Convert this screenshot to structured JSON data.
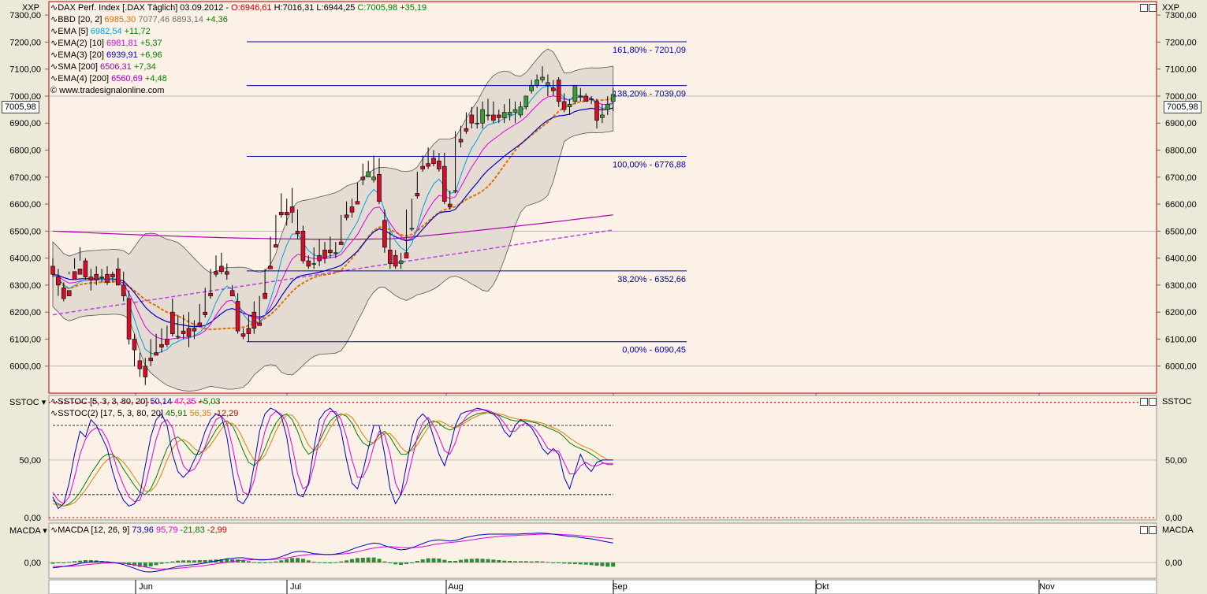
{
  "window": {
    "symbol_short": "XXP"
  },
  "legend_price": [
    {
      "parts": [
        {
          "t": "DAX Perf. Index [.DAX  Täglich] 03.09.2012 - ",
          "c": "#000"
        },
        {
          "t": "O:6946,61",
          "c": "#c00000"
        },
        {
          "t": " H:7016,31 L:6944,25 ",
          "c": "#000"
        },
        {
          "t": "C:7005,98 +35,19",
          "c": "#008000"
        }
      ]
    },
    {
      "parts": [
        {
          "t": "BBD [20, 2] ",
          "c": "#000"
        },
        {
          "t": "6985,30",
          "c": "#e07000"
        },
        {
          "t": " 7077,46 6893,14",
          "c": "#707070"
        },
        {
          "t": " +4,36",
          "c": "#008000"
        }
      ]
    },
    {
      "parts": [
        {
          "t": "EMA [5] ",
          "c": "#000"
        },
        {
          "t": "6982,54",
          "c": "#00a0e0"
        },
        {
          "t": " +11,72",
          "c": "#008000"
        }
      ]
    },
    {
      "parts": [
        {
          "t": "EMA(2) [10] ",
          "c": "#000"
        },
        {
          "t": "6981,81",
          "c": "#e000e0"
        },
        {
          "t": " +5,37",
          "c": "#008000"
        }
      ]
    },
    {
      "parts": [
        {
          "t": "EMA(3) [20] ",
          "c": "#000"
        },
        {
          "t": "6939,91",
          "c": "#0000c0"
        },
        {
          "t": " +6,96",
          "c": "#008000"
        }
      ]
    },
    {
      "parts": [
        {
          "t": "SMA [200] ",
          "c": "#000"
        },
        {
          "t": "6506,31",
          "c": "#b000b0"
        },
        {
          "t": " +7,34",
          "c": "#008000"
        }
      ]
    },
    {
      "parts": [
        {
          "t": "EMA(4) [200] ",
          "c": "#000"
        },
        {
          "t": "6560,69",
          "c": "#a000c0"
        },
        {
          "t": " +4,48",
          "c": "#008000"
        }
      ]
    },
    {
      "parts": [
        {
          "t": "© www.tradesignalonline.com",
          "c": "#000"
        }
      ]
    }
  ],
  "legend_sstoc": [
    {
      "parts": [
        {
          "t": "SSTOC [5, 3, 3, 80, 20] ",
          "c": "#000"
        },
        {
          "t": "50,14",
          "c": "#0000c0"
        },
        {
          "t": " 47,35",
          "c": "#e000e0"
        },
        {
          "t": " +5,03",
          "c": "#008000"
        }
      ]
    },
    {
      "parts": [
        {
          "t": "SSTOC(2) [17, 5, 3, 80, 20] ",
          "c": "#000"
        },
        {
          "t": "45,91",
          "c": "#008000"
        },
        {
          "t": " 56,35",
          "c": "#e08000"
        },
        {
          "t": " -12,29",
          "c": "#c00000"
        }
      ]
    }
  ],
  "legend_macd": [
    {
      "parts": [
        {
          "t": "MACDA [12, 26, 9] ",
          "c": "#000"
        },
        {
          "t": "73,96",
          "c": "#0000c0"
        },
        {
          "t": " 95,79",
          "c": "#e000e0"
        },
        {
          "t": " -21,83",
          "c": "#008000"
        },
        {
          "t": " -2,99",
          "c": "#c00000"
        }
      ]
    }
  ],
  "panes": {
    "price": "XXP",
    "sstoc": "SSTOC",
    "macd": "MACDA"
  },
  "last_price_tag": "7005,98",
  "chart_data": {
    "type": "candlestick",
    "x_labels": [
      "Jun",
      "Jul",
      "Aug",
      "Sep",
      "Okt",
      "Nov"
    ],
    "price_axis": {
      "ylim": [
        5900,
        7350
      ],
      "ticks": [
        "6000,00",
        "6100,00",
        "6200,00",
        "6300,00",
        "6400,00",
        "6500,00",
        "6600,00",
        "6700,00",
        "6800,00",
        "6900,00",
        "7000,00",
        "7100,00",
        "7200,00",
        "7300,00"
      ]
    },
    "sstoc_axis": {
      "ylim": [
        -2,
        106
      ],
      "ticks": [
        "0,00",
        "50,00"
      ]
    },
    "macd_axis": {
      "ylim": [
        -60,
        150
      ],
      "ticks": [
        "0,00"
      ]
    },
    "fib_levels": [
      {
        "label": "161,80% - 7201,09",
        "value": 7201.09
      },
      {
        "label": "138,20% - 7039,09",
        "value": 7039.09
      },
      {
        "label": "100,00% - 6776,88",
        "value": 6776.88
      },
      {
        "label": "38,20% - 6352,66",
        "value": 6352.66
      },
      {
        "label": "0,00% - 6090,45",
        "value": 6090.45
      }
    ],
    "candles": [
      [
        6370,
        6400,
        6340,
        6330
      ],
      [
        6330,
        6360,
        6300,
        6260
      ],
      [
        6290,
        6310,
        6250,
        6240
      ],
      [
        6280,
        6350,
        6260,
        6340
      ],
      [
        6350,
        6400,
        6320,
        6360
      ],
      [
        6360,
        6440,
        6340,
        6390
      ],
      [
        6390,
        6400,
        6330,
        6320
      ],
      [
        6330,
        6360,
        6320,
        6280
      ],
      [
        6340,
        6370,
        6320,
        6300
      ],
      [
        6330,
        6360,
        6330,
        6310
      ],
      [
        6340,
        6370,
        6310,
        6300
      ],
      [
        6340,
        6350,
        6330,
        6310
      ],
      [
        6360,
        6400,
        6300,
        6300
      ],
      [
        6300,
        6350,
        6260,
        6240
      ],
      [
        6250,
        6280,
        6100,
        6080
      ],
      [
        6100,
        6120,
        6060,
        6000
      ],
      [
        6020,
        6050,
        5990,
        5960
      ],
      [
        6000,
        6030,
        5960,
        5930
      ],
      [
        6030,
        6100,
        6020,
        6000
      ],
      [
        6050,
        6120,
        6040,
        6040
      ],
      [
        6080,
        6140,
        6070,
        6050
      ],
      [
        6100,
        6150,
        6080,
        6070
      ],
      [
        6200,
        6250,
        6120,
        6110
      ],
      [
        6110,
        6190,
        6110,
        6100
      ],
      [
        6130,
        6190,
        6120,
        6100
      ],
      [
        6140,
        6200,
        6110,
        6070
      ],
      [
        6140,
        6170,
        6130,
        6100
      ],
      [
        6160,
        6230,
        6150,
        6150
      ],
      [
        6200,
        6290,
        6190,
        6180
      ],
      [
        6270,
        6360,
        6260,
        6250
      ],
      [
        6350,
        6410,
        6340,
        6330
      ],
      [
        6370,
        6420,
        6350,
        6340
      ],
      [
        6350,
        6380,
        6340,
        6320
      ],
      [
        6280,
        6300,
        6260,
        6260
      ],
      [
        6240,
        6270,
        6130,
        6120
      ],
      [
        6120,
        6140,
        6110,
        6100
      ],
      [
        6140,
        6190,
        6120,
        6090
      ],
      [
        6200,
        6240,
        6140,
        6120
      ],
      [
        6160,
        6260,
        6150,
        6150
      ],
      [
        6270,
        6360,
        6250,
        6250
      ],
      [
        6370,
        6480,
        6360,
        6360
      ],
      [
        6450,
        6560,
        6440,
        6440
      ],
      [
        6570,
        6640,
        6560,
        6550
      ],
      [
        6570,
        6620,
        6560,
        6520
      ],
      [
        6590,
        6660,
        6570,
        6530
      ],
      [
        6500,
        6580,
        6490,
        6470
      ],
      [
        6500,
        6520,
        6390,
        6380
      ],
      [
        6390,
        6410,
        6370,
        6360
      ],
      [
        6380,
        6440,
        6380,
        6360
      ],
      [
        6410,
        6470,
        6390,
        6370
      ],
      [
        6430,
        6460,
        6400,
        6380
      ],
      [
        6430,
        6480,
        6420,
        6400
      ],
      [
        6420,
        6460,
        6420,
        6400
      ],
      [
        6460,
        6560,
        6450,
        6450
      ],
      [
        6560,
        6610,
        6550,
        6540
      ],
      [
        6590,
        6620,
        6570,
        6550
      ],
      [
        6610,
        6680,
        6600,
        6600
      ],
      [
        6700,
        6750,
        6690,
        6670
      ],
      [
        6700,
        6760,
        6720,
        6720
      ],
      [
        6690,
        6780,
        6700,
        6680
      ],
      [
        6710,
        6770,
        6610,
        6600
      ],
      [
        6540,
        6580,
        6440,
        6420
      ],
      [
        6430,
        6500,
        6380,
        6360
      ],
      [
        6410,
        6430,
        6370,
        6360
      ],
      [
        6380,
        6420,
        6390,
        6360
      ],
      [
        6420,
        6580,
        6400,
        6400
      ],
      [
        6510,
        6620,
        6510,
        6500
      ],
      [
        6640,
        6720,
        6630,
        6620
      ],
      [
        6740,
        6780,
        6730,
        6720
      ],
      [
        6750,
        6810,
        6740,
        6730
      ],
      [
        6770,
        6800,
        6750,
        6740
      ],
      [
        6760,
        6790,
        6730,
        6720
      ],
      [
        6740,
        6790,
        6610,
        6600
      ],
      [
        6600,
        6650,
        6590,
        6580
      ],
      [
        6650,
        6870,
        6650,
        6640
      ],
      [
        6840,
        6890,
        6830,
        6810
      ],
      [
        6880,
        6940,
        6870,
        6860
      ],
      [
        6930,
        6960,
        6900,
        6880
      ],
      [
        6900,
        6960,
        6900,
        6880
      ],
      [
        6900,
        6980,
        6950,
        6880
      ],
      [
        6930,
        6990,
        6930,
        6910
      ],
      [
        6930,
        6980,
        6910,
        6900
      ],
      [
        6930,
        6950,
        6920,
        6900
      ],
      [
        6920,
        6970,
        6940,
        6900
      ],
      [
        6930,
        6990,
        6940,
        6910
      ],
      [
        6940,
        6980,
        6950,
        6900
      ],
      [
        6930,
        6980,
        6960,
        6920
      ],
      [
        6960,
        7000,
        7000,
        6950
      ],
      [
        7020,
        7060,
        7040,
        7010
      ],
      [
        7040,
        7080,
        7060,
        7030
      ],
      [
        7060,
        7110,
        7070,
        7050
      ],
      [
        7040,
        7080,
        7050,
        7000
      ],
      [
        7030,
        7060,
        7020,
        7000
      ],
      [
        7060,
        7070,
        6980,
        6960
      ],
      [
        6980,
        7010,
        6950,
        6940
      ],
      [
        6960,
        6990,
        6970,
        6930
      ],
      [
        6980,
        7030,
        7040,
        6970
      ],
      [
        7000,
        7030,
        7000,
        6980
      ],
      [
        7000,
        7010,
        6980,
        6980
      ],
      [
        6990,
        7000,
        6990,
        6970
      ],
      [
        6980,
        6990,
        6910,
        6880
      ],
      [
        6920,
        6970,
        6930,
        6900
      ],
      [
        6950,
        7000,
        6970,
        6930
      ],
      [
        6980,
        7030,
        7005.98,
        6944.25
      ]
    ],
    "sstoc_fast": [
      18,
      8,
      12,
      30,
      55,
      75,
      70,
      85,
      80,
      70,
      60,
      40,
      25,
      15,
      10,
      12,
      20,
      45,
      70,
      85,
      90,
      80,
      55,
      40,
      35,
      40,
      50,
      60,
      75,
      85,
      90,
      88,
      70,
      40,
      15,
      12,
      20,
      45,
      75,
      90,
      95,
      93,
      88,
      70,
      40,
      20,
      18,
      30,
      60,
      85,
      92,
      95,
      90,
      75,
      50,
      30,
      25,
      40,
      60,
      80,
      80,
      55,
      25,
      12,
      20,
      45,
      70,
      85,
      90,
      85,
      70,
      55,
      45,
      60,
      80,
      90,
      92,
      93,
      95,
      94,
      92,
      90,
      85,
      75,
      70,
      80,
      85,
      82,
      78,
      70,
      60,
      55,
      60,
      55,
      35,
      25,
      40,
      55,
      45,
      40,
      48,
      50,
      50,
      50
    ],
    "sstoc_slow": [
      22,
      15,
      12,
      18,
      35,
      55,
      68,
      75,
      78,
      76,
      68,
      55,
      40,
      28,
      18,
      14,
      15,
      28,
      48,
      68,
      82,
      85,
      78,
      60,
      45,
      40,
      42,
      50,
      62,
      75,
      85,
      88,
      82,
      62,
      38,
      22,
      20,
      32,
      55,
      75,
      88,
      92,
      90,
      82,
      62,
      38,
      25,
      28,
      45,
      68,
      85,
      92,
      92,
      85,
      70,
      50,
      35,
      35,
      45,
      62,
      75,
      72,
      55,
      30,
      20,
      30,
      50,
      70,
      82,
      87,
      80,
      70,
      58,
      55,
      65,
      80,
      88,
      92,
      93,
      94,
      93,
      91,
      88,
      82,
      75,
      75,
      80,
      82,
      80,
      75,
      68,
      60,
      58,
      58,
      48,
      38,
      38,
      45,
      48,
      45,
      45,
      47,
      47,
      47
    ],
    "sstoc2_a": [
      15,
      12,
      10,
      12,
      16,
      22,
      30,
      38,
      45,
      52,
      55,
      55,
      50,
      42,
      35,
      28,
      22,
      20,
      25,
      35,
      48,
      60,
      68,
      70,
      66,
      60,
      55,
      55,
      60,
      68,
      76,
      82,
      84,
      80,
      70,
      58,
      48,
      45,
      50,
      60,
      72,
      82,
      88,
      90,
      85,
      75,
      62,
      55,
      58,
      66,
      76,
      84,
      88,
      90,
      88,
      82,
      72,
      65,
      62,
      65,
      72,
      75,
      70,
      62,
      55,
      55,
      60,
      68,
      76,
      82,
      84,
      82,
      78,
      76,
      78,
      82,
      85,
      88,
      90,
      91,
      91,
      90,
      89,
      87,
      85,
      84,
      84,
      84,
      83,
      82,
      80,
      78,
      76,
      74,
      70,
      65,
      62,
      60,
      58,
      55,
      52,
      48,
      46,
      46
    ],
    "sstoc2_b": [
      12,
      11,
      10,
      11,
      13,
      18,
      24,
      31,
      38,
      45,
      50,
      53,
      52,
      48,
      42,
      35,
      28,
      23,
      23,
      28,
      38,
      50,
      60,
      66,
      68,
      65,
      60,
      57,
      58,
      63,
      70,
      77,
      82,
      82,
      77,
      68,
      58,
      50,
      49,
      54,
      64,
      75,
      84,
      89,
      89,
      83,
      73,
      63,
      58,
      61,
      69,
      78,
      85,
      89,
      90,
      87,
      80,
      72,
      66,
      65,
      69,
      73,
      73,
      68,
      61,
      57,
      58,
      63,
      71,
      78,
      83,
      84,
      82,
      79,
      78,
      80,
      83,
      86,
      88,
      90,
      91,
      91,
      90,
      89,
      87,
      86,
      85,
      85,
      84,
      83,
      82,
      80,
      78,
      76,
      73,
      69,
      66,
      63,
      61,
      59,
      56,
      53,
      50,
      50
    ]
  },
  "macd": {
    "line": [
      -20,
      -18,
      -15,
      -12,
      -8,
      -4,
      0,
      2,
      3,
      3,
      2,
      0,
      -3,
      -8,
      -15,
      -22,
      -30,
      -35,
      -36,
      -34,
      -30,
      -25,
      -20,
      -15,
      -12,
      -10,
      -8,
      -5,
      -2,
      2,
      6,
      10,
      14,
      16,
      18,
      18,
      15,
      12,
      10,
      10,
      12,
      16,
      22,
      30,
      38,
      42,
      42,
      38,
      34,
      32,
      30,
      30,
      32,
      36,
      42,
      50,
      58,
      64,
      70,
      74,
      72,
      64,
      58,
      52,
      48,
      50,
      56,
      64,
      72,
      80,
      84,
      86,
      84,
      82,
      84,
      90,
      96,
      100,
      104,
      106,
      108,
      108,
      108,
      108,
      108,
      108,
      109,
      110,
      110,
      112,
      112,
      110,
      108,
      105,
      102,
      100,
      98,
      95,
      92,
      90,
      86,
      82,
      78,
      74
    ],
    "signal": [
      -15,
      -15,
      -15,
      -14,
      -13,
      -11,
      -9,
      -7,
      -5,
      -3,
      -2,
      -1,
      -2,
      -3,
      -6,
      -9,
      -13,
      -17,
      -21,
      -24,
      -25,
      -25,
      -24,
      -22,
      -20,
      -18,
      -16,
      -14,
      -11,
      -8,
      -5,
      -2,
      1,
      4,
      7,
      9,
      10,
      11,
      11,
      11,
      11,
      12,
      14,
      17,
      21,
      25,
      28,
      30,
      31,
      31,
      31,
      31,
      31,
      32,
      34,
      37,
      41,
      46,
      51,
      55,
      58,
      60,
      60,
      59,
      57,
      56,
      56,
      58,
      60,
      64,
      68,
      71,
      74,
      76,
      78,
      80,
      83,
      86,
      89,
      92,
      95,
      97,
      99,
      101,
      102,
      103,
      104,
      105,
      106,
      107,
      108,
      108,
      108,
      107,
      106,
      105,
      104,
      102,
      100,
      98,
      96,
      94,
      92,
      90
    ],
    "hist": [
      -5,
      -3,
      0,
      2,
      5,
      7,
      9,
      9,
      8,
      6,
      4,
      1,
      -1,
      -5,
      -9,
      -13,
      -17,
      -18,
      -15,
      -10,
      -5,
      0,
      4,
      7,
      8,
      8,
      8,
      9,
      9,
      10,
      11,
      12,
      13,
      12,
      11,
      9,
      5,
      1,
      -1,
      -1,
      1,
      4,
      8,
      13,
      17,
      17,
      14,
      8,
      3,
      1,
      -1,
      -1,
      1,
      4,
      8,
      13,
      17,
      18,
      19,
      19,
      14,
      4,
      -2,
      -7,
      -9,
      -6,
      0,
      6,
      12,
      16,
      16,
      15,
      10,
      6,
      6,
      10,
      13,
      14,
      15,
      14,
      13,
      11,
      9,
      7,
      6,
      5,
      5,
      5,
      4,
      5,
      4,
      2,
      0,
      -2,
      -4,
      -5,
      -6,
      -7,
      -8,
      -10,
      -12,
      -14,
      -16,
      -16
    ]
  }
}
